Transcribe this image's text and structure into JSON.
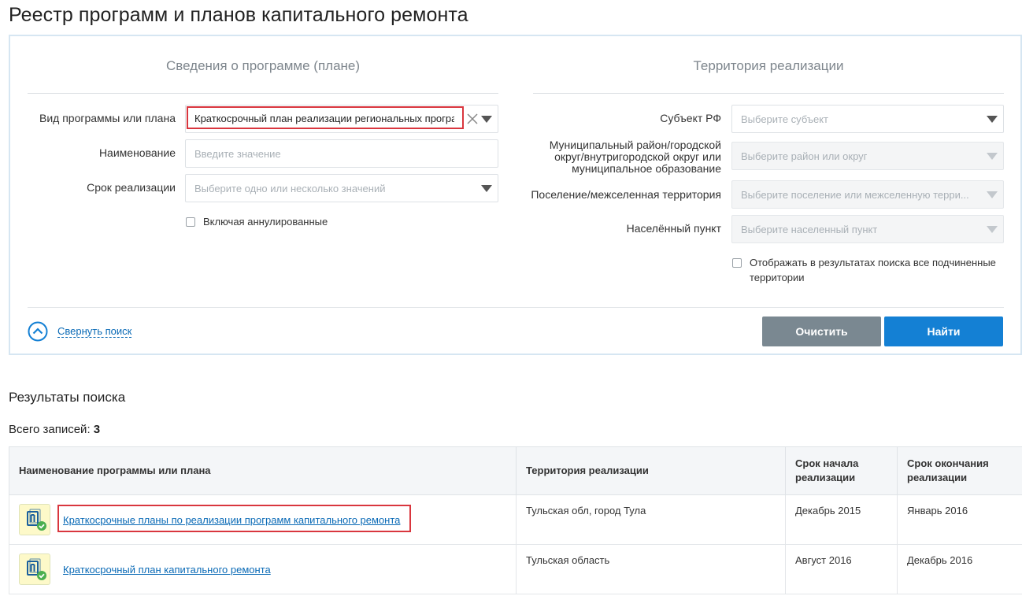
{
  "page": {
    "title": "Реестр программ и планов капитального ремонта"
  },
  "left_section": {
    "title": "Сведения о программе (плане)",
    "program_type": {
      "label": "Вид программы или плана",
      "value": "Краткосрочный план реализации региональных програ..."
    },
    "name": {
      "label": "Наименование",
      "placeholder": "Введите значение"
    },
    "period": {
      "label": "Срок реализации",
      "placeholder": "Выберите одно или несколько значений"
    },
    "include_cancelled": {
      "label": "Включая аннулированные",
      "checked": false
    }
  },
  "right_section": {
    "title": "Территория реализации",
    "subject": {
      "label": "Субъект РФ",
      "placeholder": "Выберите субъект"
    },
    "district": {
      "label_lines": [
        "Муниципальный район/городской",
        "округ/внутригородской округ или",
        "муниципальное образование"
      ],
      "placeholder": "Выберите район или округ"
    },
    "settlement": {
      "label": "Поселение/межселенная территория",
      "placeholder": "Выберите поселение или межселенную терри..."
    },
    "locality": {
      "label": "Населённый пункт",
      "placeholder": "Выберите населенный пункт"
    },
    "show_subordinate": {
      "label_lines": [
        "Отображать в результатах поиска все подчиненные",
        "территории"
      ],
      "checked": false
    }
  },
  "actions": {
    "collapse": "Свернуть поиск",
    "clear": "Очистить",
    "find": "Найти"
  },
  "results": {
    "title": "Результаты поиска",
    "total_label": "Всего записей:",
    "total_count": "3",
    "columns": [
      "Наименование программы или плана",
      "Территория реализации",
      "Срок начала реализации",
      "Срок окончания реализации"
    ],
    "rows": [
      {
        "name": "Краткосрочные планы по реализации программ капитального ремонта",
        "territory": "Тульская обл, город Тула",
        "start": "Декабрь 2015",
        "end": "Январь 2016"
      },
      {
        "name": "Краткосрочный план капитального ремонта",
        "territory": "Тульская область",
        "start": "Август 2016",
        "end": "Декабрь 2016"
      }
    ]
  },
  "colors": {
    "accent": "#1480d4",
    "link": "#0a6ab6",
    "highlight": "#d9363e",
    "clear_button": "#7a8891",
    "doc_icon_bg": "#fdf9c9",
    "check_green": "#4caf50"
  }
}
